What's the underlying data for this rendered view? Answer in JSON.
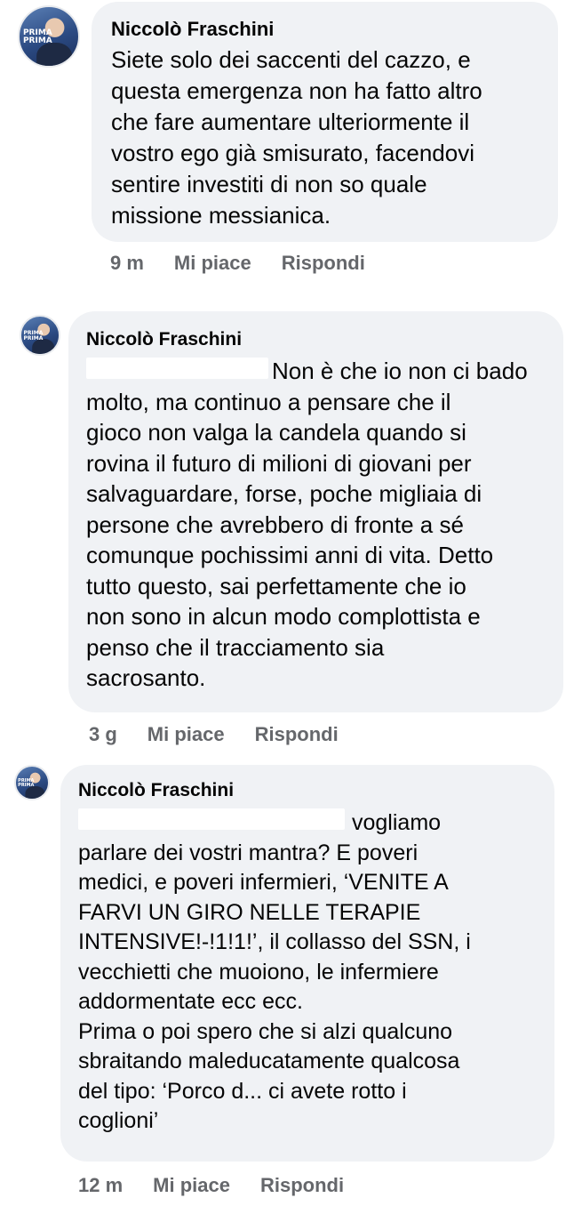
{
  "comments": [
    {
      "author": "Niccolò Fraschini",
      "avatar_logo": "PRIMA PRIMA",
      "text": "Siete solo dei saccenti del cazzo, e\nquesta emergenza non ha fatto altro\nche fare aumentare ulteriormente il\nvostro ego già smisurato, facendovi\nsentire investiti di non so quale\nmissione messianica.",
      "time": "9 m",
      "like_label": "Mi piace",
      "reply_label": "Rispondi"
    },
    {
      "author": "Niccolò Fraschini",
      "avatar_logo": "PRIMA PRIMA",
      "text": "Non è che io non ci bado\nmolto, ma continuo a pensare che il\ngioco non valga la candela quando si\nrovina il futuro di milioni di giovani per\nsalvaguardare, forse, poche migliaia di\npersone che avrebbero di fronte a sé\ncomunque pochissimi anni di vita. Detto\ntutto questo, sai perfettamente che io\nnon sono in alcun modo complottista e\npenso che il tracciamento sia\nsacrosanto.",
      "time": "3 g",
      "like_label": "Mi piace",
      "reply_label": "Rispondi"
    },
    {
      "author": "Niccolò Fraschini",
      "avatar_logo": "PRIMA PRIMA",
      "text": "vogliamo\nparlare dei vostri mantra? E poveri\nmedici, e poveri infermieri, ‘VENITE A\nFARVI UN GIRO NELLE TERAPIE\nINTENSIVE!-!1!1!’, il collasso del SSN, i\nvecchietti che muoiono, le infermiere\naddormentate ecc ecc.\nPrima o poi spero che si alzi qualcuno\nsbraitando maleducatamente qualcosa\ndel tipo: ‘Porco d... ci avete rotto i\ncoglioni’",
      "time": "12 m",
      "like_label": "Mi piace",
      "reply_label": "Rispondi"
    }
  ],
  "colors": {
    "bubble": "#f0f2f5",
    "meta": "#65676b",
    "text": "#050505"
  }
}
